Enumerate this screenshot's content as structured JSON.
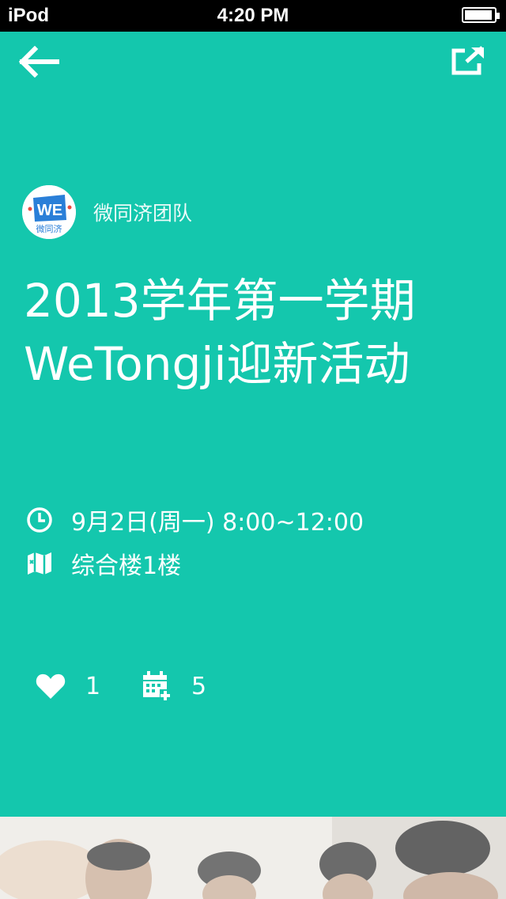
{
  "status_bar": {
    "carrier": "iPod",
    "time": "4:20 PM",
    "battery_level": 0.95
  },
  "nav": {
    "back_icon": "arrow-left-icon",
    "share_icon": "share-external-icon"
  },
  "organizer": {
    "logo_icon": "wetongji-logo",
    "logo_text": "WE",
    "logo_subtext": "微同济",
    "name": "微同济团队"
  },
  "event": {
    "title_line1": "2013学年第一学期",
    "title_line2": "WeTongji迎新活动",
    "time": "9月2日(周一) 8:00~12:00",
    "location": "综合楼1楼"
  },
  "stats": {
    "likes": "1",
    "schedules": "5"
  },
  "colors": {
    "background": "#14c7ad",
    "text": "#ffffff",
    "logo_blue": "#2a7fd8"
  },
  "photo": {
    "description_icon": "event-photo"
  }
}
